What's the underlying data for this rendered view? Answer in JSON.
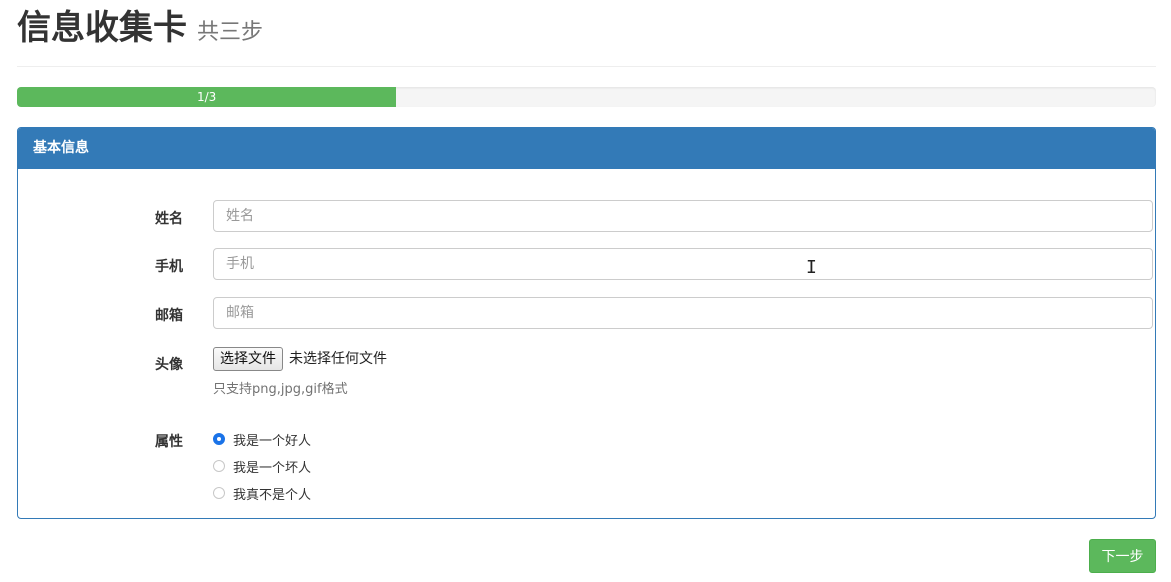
{
  "header": {
    "title": "信息收集卡",
    "subtitle": "共三步"
  },
  "progress": {
    "label": "1/3",
    "fraction": 0.333
  },
  "panel": {
    "heading": "基本信息",
    "fields": {
      "name": {
        "label": "姓名",
        "placeholder": "姓名"
      },
      "phone": {
        "label": "手机",
        "placeholder": "手机"
      },
      "email": {
        "label": "邮箱",
        "placeholder": "邮箱"
      },
      "avatar": {
        "label": "头像",
        "button": "选择文件",
        "status": "未选择任何文件",
        "help": "只支持png,jpg,gif格式"
      },
      "attribute": {
        "label": "属性",
        "options": [
          {
            "label": "我是一个好人",
            "checked": true
          },
          {
            "label": "我是一个坏人",
            "checked": false
          },
          {
            "label": "我真不是个人",
            "checked": false
          }
        ]
      }
    }
  },
  "actions": {
    "next": "下一步"
  },
  "colors": {
    "primary": "#337ab7",
    "success": "#5cb85c"
  }
}
